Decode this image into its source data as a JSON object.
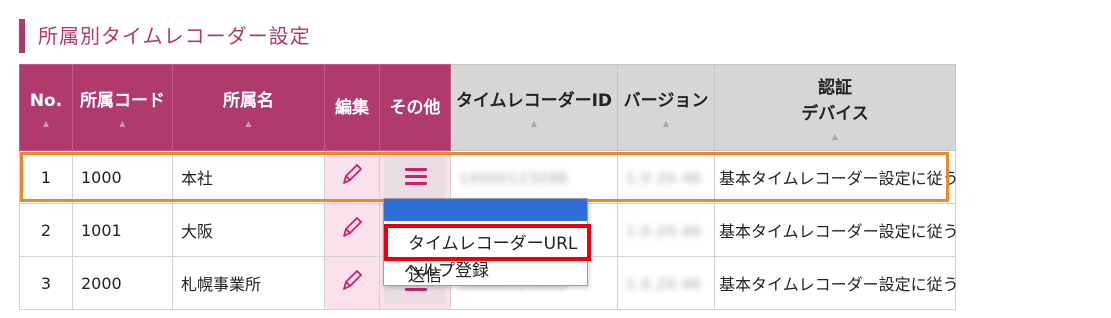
{
  "page": {
    "section_title": "所属別タイムレコーダー設定"
  },
  "table": {
    "headers": {
      "no": "No.",
      "code": "所属コード",
      "name": "所属名",
      "edit": "編集",
      "other": "その他",
      "tr_id": "タイムレコーダーID",
      "version": "バージョン",
      "auth_line1": "認証",
      "auth_line2": "デバイス"
    },
    "sort_icon": "▲",
    "rows": [
      {
        "no": "1",
        "code": "1000",
        "name": "本社",
        "tr_id": "14000123598",
        "version": "1.0.20.46",
        "device": "基本タイムレコーダー設定に従う"
      },
      {
        "no": "2",
        "code": "1001",
        "name": "大阪",
        "tr_id": "14000123599",
        "version": "1.0.20.46",
        "device": "基本タイムレコーダー設定に従う"
      },
      {
        "no": "3",
        "code": "2000",
        "name": "札幌事業所",
        "tr_id": "14000123600",
        "version": "1.0.20.46",
        "device": "基本タイムレコーダー設定に従う"
      }
    ]
  },
  "dropdown": {
    "items": [
      {
        "label": "タイムレコーダーURL送信"
      },
      {
        "label": "ヘルプ登録"
      }
    ]
  },
  "colors": {
    "accent": "#b03a6e",
    "edit_bg": "#fbe1ec",
    "highlight_row": "#e8892b",
    "highlight_item": "#e60012",
    "menu_icon": "#cc1f6e",
    "dropdown_bar": "#2f6ed8"
  },
  "icons": {
    "edit": "pencil-icon",
    "other": "hamburger-menu-icon"
  }
}
